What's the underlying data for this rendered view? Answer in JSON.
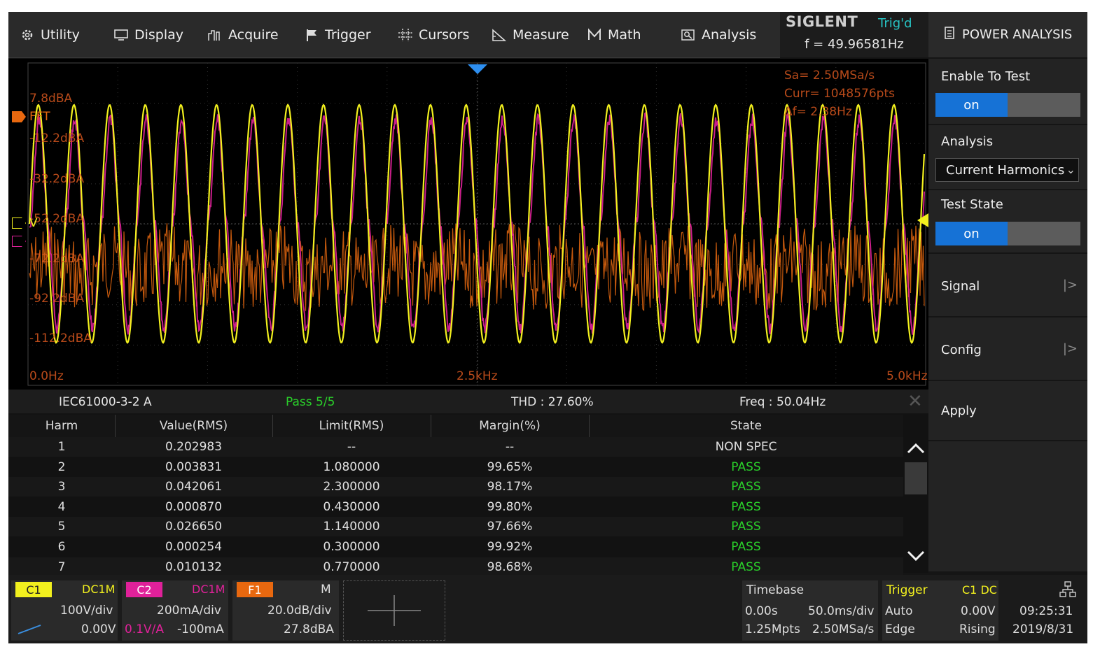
{
  "menu": {
    "utility": "Utility",
    "display": "Display",
    "acquire": "Acquire",
    "trigger": "Trigger",
    "cursors": "Cursors",
    "measure": "Measure",
    "math": "Math",
    "analysis": "Analysis"
  },
  "brand": {
    "logo": "SIGLENT",
    "status": "Trig'd",
    "frequency": "f = 49.96581Hz"
  },
  "panel": {
    "title": "POWER ANALYSIS",
    "enable_label": "Enable To Test",
    "enable_value": "on",
    "analysis_label": "Analysis",
    "analysis_value": "Current Harmonics",
    "test_state_label": "Test State",
    "test_state_value": "on",
    "signal_label": "Signal",
    "config_label": "Config",
    "apply_label": "Apply"
  },
  "scope": {
    "sample_rate": "Sa=  2.50MSa/s",
    "curr_points": "Curr= 1048576pts",
    "delta_f": "Δf= 2.38Hz",
    "levels": [
      "7.8dBA",
      "-12.2dBA",
      "-32.2dBA",
      "-52.2dBA",
      "-72.2dBA",
      "-92.2dBA",
      "-112.2dBA"
    ],
    "freq_start": "0.0Hz",
    "freq_mid": "2.5kHz",
    "freq_end": "5.0kHz",
    "fft_marker": "FFT",
    "v_marker": "V",
    "colors": {
      "ch1": "#f2f01e",
      "ch2": "#e0219a",
      "fft": "#e8680f"
    }
  },
  "results": {
    "standard": "IEC61000-3-2 A",
    "pass": "Pass 5/5",
    "thd": "THD : 27.60%",
    "freq": "Freq : 50.04Hz",
    "headers": [
      "Harm",
      "Value(RMS)",
      "Limit(RMS)",
      "Margin(%)",
      "State"
    ],
    "rows": [
      [
        "1",
        "0.202983",
        "--",
        "--",
        "NON SPEC"
      ],
      [
        "2",
        "0.003831",
        "1.080000",
        "99.65%",
        "PASS"
      ],
      [
        "3",
        "0.042061",
        "2.300000",
        "98.17%",
        "PASS"
      ],
      [
        "4",
        "0.000870",
        "0.430000",
        "99.80%",
        "PASS"
      ],
      [
        "5",
        "0.026650",
        "1.140000",
        "97.66%",
        "PASS"
      ],
      [
        "6",
        "0.000254",
        "0.300000",
        "99.92%",
        "PASS"
      ],
      [
        "7",
        "0.010132",
        "0.770000",
        "98.68%",
        "PASS"
      ]
    ]
  },
  "channels": {
    "c1": {
      "tag": "C1",
      "coupling": "DC1M",
      "scale": "100V/div",
      "offset": "0.00V"
    },
    "c2": {
      "tag": "C2",
      "coupling": "DC1M",
      "scale": "200mA/div",
      "probe": "0.1V/A",
      "offset": "-100mA"
    },
    "f1": {
      "tag": "F1",
      "mode": "M",
      "scale": "20.0dB/div",
      "offset": "27.8dBA"
    }
  },
  "timebase": {
    "label": "Timebase",
    "delay": "0.00s",
    "scale": "50.0ms/div",
    "points": "1.25Mpts",
    "rate": "2.50MSa/s"
  },
  "trigger": {
    "label": "Trigger",
    "source": "C1 DC",
    "mode": "Auto",
    "level": "0.00V",
    "type": "Edge",
    "slope": "Rising"
  },
  "clock": {
    "time": "09:25:31",
    "date": "2019/8/31"
  }
}
